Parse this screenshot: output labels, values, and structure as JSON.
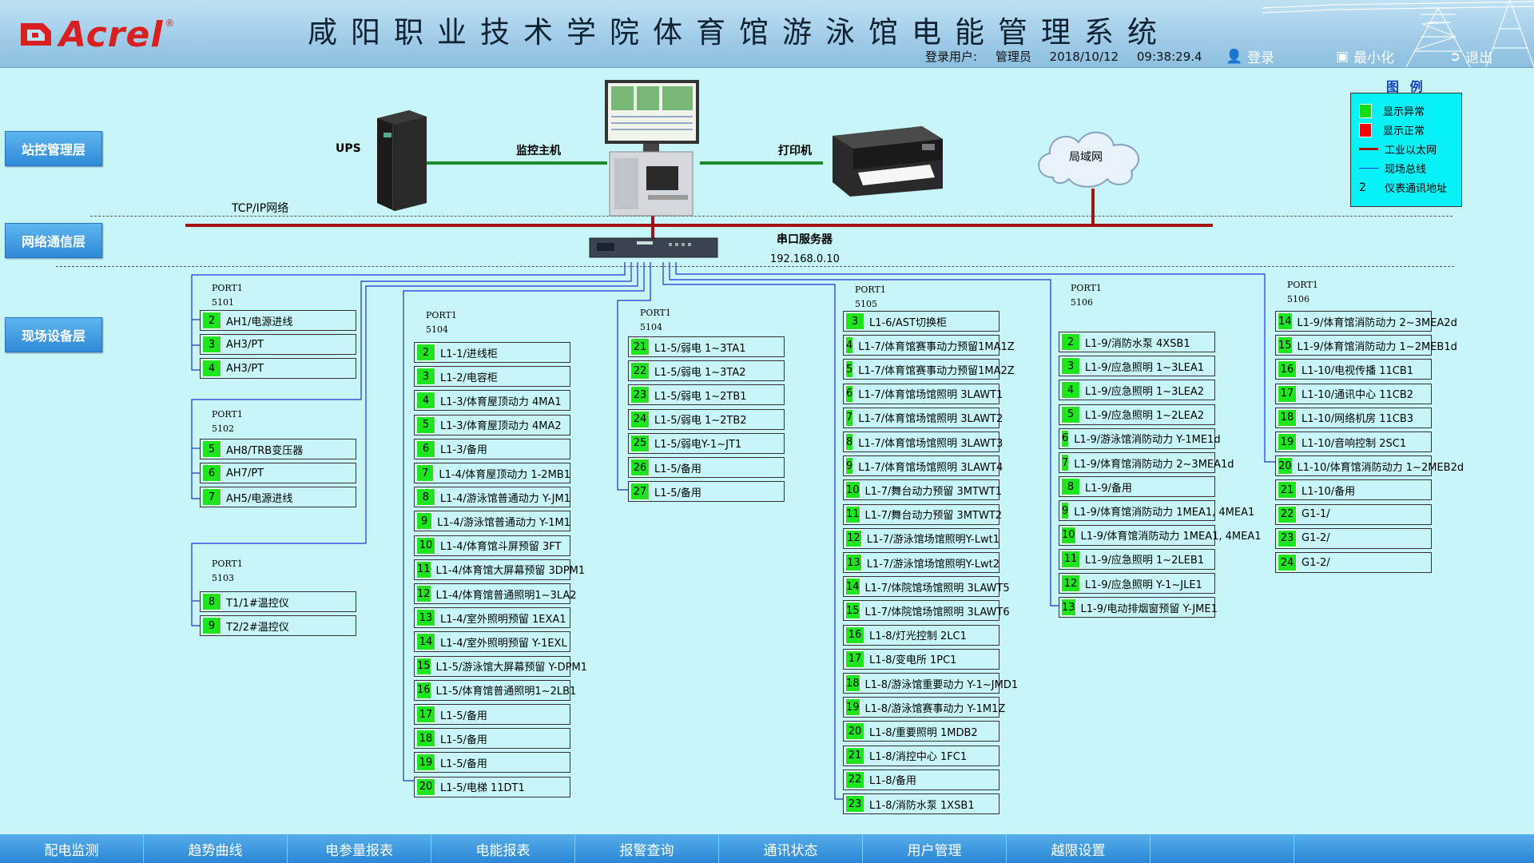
{
  "header": {
    "logo": "Acrel",
    "title": "咸阳职业技术学院体育馆游泳馆电能管理系统",
    "user_label": "登录用户:",
    "user": "管理员",
    "date": "2018/10/12",
    "time": "09:38:29.4",
    "login": "登录",
    "minimize": "最小化",
    "exit": "退出"
  },
  "layers": [
    "站控管理层",
    "网络通信层",
    "现场设备层"
  ],
  "topology": {
    "ups": "UPS",
    "host": "监控主机",
    "printer": "打印机",
    "lan": "局域网",
    "tcp": "TCP/IP网络",
    "serial_server": "串口服务器",
    "serial_ip": "192.168.0.10"
  },
  "legend": {
    "title": "图 例",
    "items": [
      "显示异常",
      "显示正常",
      "工业以太网",
      "现场总线",
      "仪表通讯地址"
    ],
    "addr_sample": "2",
    "colors": {
      "abnormal": "#11dd11",
      "normal": "#ff0000",
      "ethernet": "#aa1111",
      "fieldbus": "#2233dd"
    }
  },
  "groups": [
    {
      "port": "PORT1",
      "sub": "5101",
      "devices": [
        [
          "2",
          "AH1/电源进线"
        ],
        [
          "3",
          "AH3/PT"
        ],
        [
          "4",
          "AH3/PT"
        ]
      ]
    },
    {
      "port": "PORT1",
      "sub": "5102",
      "devices": [
        [
          "5",
          "AH8/TRB变压器"
        ],
        [
          "6",
          "AH7/PT"
        ],
        [
          "7",
          "AH5/电源进线"
        ]
      ]
    },
    {
      "port": "PORT1",
      "sub": "5103",
      "devices": [
        [
          "8",
          "T1/1#温控仪"
        ],
        [
          "9",
          "T2/2#温控仪"
        ]
      ]
    },
    {
      "port": "PORT1",
      "sub": "5104",
      "devices": [
        [
          "2",
          "L1-1/进线柜"
        ],
        [
          "3",
          "L1-2/电容柜"
        ],
        [
          "4",
          "L1-3/体育屋顶动力 4MA1"
        ],
        [
          "5",
          "L1-3/体育屋顶动力 4MA2"
        ],
        [
          "6",
          "L1-3/备用"
        ],
        [
          "7",
          "L1-4/体育屋顶动力 1-2MB1"
        ],
        [
          "8",
          "L1-4/游泳馆普通动力 Y-JM1"
        ],
        [
          "9",
          "L1-4/游泳馆普通动力 Y-1M1"
        ],
        [
          "10",
          "L1-4/体育馆斗屏预留 3FT"
        ],
        [
          "11",
          "L1-4/体育馆大屏幕预留 3DPM1"
        ],
        [
          "12",
          "L1-4/体育馆普通照明1~3LA2"
        ],
        [
          "13",
          "L1-4/室外照明预留 1EXA1"
        ],
        [
          "14",
          "L1-4/室外照明预留 Y-1EXL"
        ],
        [
          "15",
          "L1-5/游泳馆大屏幕预留 Y-DPM1"
        ],
        [
          "16",
          "L1-5/体育馆普通照明1~2LB1"
        ],
        [
          "17",
          "L1-5/备用"
        ],
        [
          "18",
          "L1-5/备用"
        ],
        [
          "19",
          "L1-5/备用"
        ],
        [
          "20",
          "L1-5/电梯 11DT1"
        ]
      ]
    },
    {
      "port": "PORT1",
      "sub": "5104",
      "devices": [
        [
          "21",
          "L1-5/弱电 1~3TA1"
        ],
        [
          "22",
          "L1-5/弱电 1~3TA2"
        ],
        [
          "23",
          "L1-5/弱电 1~2TB1"
        ],
        [
          "24",
          "L1-5/弱电 1~2TB2"
        ],
        [
          "25",
          "L1-5/弱电Y-1~JT1"
        ],
        [
          "26",
          "L1-5/备用"
        ],
        [
          "27",
          "L1-5/备用"
        ]
      ]
    },
    {
      "port": "PORT1",
      "sub": "5105",
      "devices": [
        [
          "3",
          "L1-6/AST切换柜"
        ],
        [
          "4",
          "L1-7/体育馆赛事动力预留1MA1Z"
        ],
        [
          "5",
          "L1-7/体育馆赛事动力预留1MA2Z"
        ],
        [
          "6",
          "L1-7/体育馆场馆照明 3LAWT1"
        ],
        [
          "7",
          "L1-7/体育馆场馆照明 3LAWT2"
        ],
        [
          "8",
          "L1-7/体育馆场馆照明 3LAWT3"
        ],
        [
          "9",
          "L1-7/体育馆场馆照明 3LAWT4"
        ],
        [
          "10",
          "L1-7/舞台动力预留 3MTWT1"
        ],
        [
          "11",
          "L1-7/舞台动力预留 3MTWT2"
        ],
        [
          "12",
          "L1-7/游泳馆场馆照明Y-Lwt1"
        ],
        [
          "13",
          "L1-7/游泳馆场馆照明Y-Lwt2"
        ],
        [
          "14",
          "L1-7/体院馆场馆照明 3LAWT5"
        ],
        [
          "15",
          "L1-7/体院馆场馆照明 3LAWT6"
        ],
        [
          "16",
          "L1-8/灯光控制 2LC1"
        ],
        [
          "17",
          "L1-8/变电所 1PC1"
        ],
        [
          "18",
          "L1-8/游泳馆重要动力 Y-1~JMD1"
        ],
        [
          "19",
          "L1-8/游泳馆赛事动力 Y-1M1Z"
        ],
        [
          "20",
          "L1-8/重要照明 1MDB2"
        ],
        [
          "21",
          "L1-8/消控中心 1FC1"
        ],
        [
          "22",
          "L1-8/备用"
        ],
        [
          "23",
          "L1-8/消防水泵 1XSB1"
        ]
      ]
    },
    {
      "port": "PORT1",
      "sub": "5106",
      "devices": [
        [
          "2",
          "L1-9/消防水泵 4XSB1"
        ],
        [
          "3",
          "L1-9/应急照明 1~3LEA1"
        ],
        [
          "4",
          "L1-9/应急照明 1~3LEA2"
        ],
        [
          "5",
          "L1-9/应急照明 1~2LEA2"
        ],
        [
          "6",
          "L1-9/游泳馆消防动力 Y-1ME1d"
        ],
        [
          "7",
          "L1-9/体育馆消防动力 2~3MEA1d"
        ],
        [
          "8",
          "L1-9/备用"
        ],
        [
          "9",
          "L1-9/体育馆消防动力 1MEA1, 4MEA1"
        ],
        [
          "10",
          "L1-9/体育馆消防动力 1MEA1, 4MEA1"
        ],
        [
          "11",
          "L1-9/应急照明 1~2LEB1"
        ],
        [
          "12",
          "L1-9/应急照明 Y-1~JLE1"
        ],
        [
          "13",
          "L1-9/电动排烟窗预留 Y-JME1"
        ]
      ]
    },
    {
      "port": "PORT1",
      "sub": "5106",
      "devices": [
        [
          "14",
          "L1-9/体育馆消防动力 2~3MEA2d"
        ],
        [
          "15",
          "L1-9/体育馆消防动力 1~2MEB1d"
        ],
        [
          "16",
          "L1-10/电视传播 11CB1"
        ],
        [
          "17",
          "L1-10/通讯中心 11CB2"
        ],
        [
          "18",
          "L1-10/网络机房 11CB3"
        ],
        [
          "19",
          "L1-10/音响控制 2SC1"
        ],
        [
          "20",
          "L1-10/体育馆消防动力 1~2MEB2d"
        ],
        [
          "21",
          "L1-10/备用"
        ],
        [
          "22",
          "G1-1/"
        ],
        [
          "23",
          "G1-2/"
        ],
        [
          "24",
          "G1-2/"
        ]
      ]
    }
  ],
  "bottom_tabs": [
    "配电监测",
    "趋势曲线",
    "电参量报表",
    "电能报表",
    "报警查询",
    "通讯状态",
    "用户管理",
    "越限设置"
  ]
}
